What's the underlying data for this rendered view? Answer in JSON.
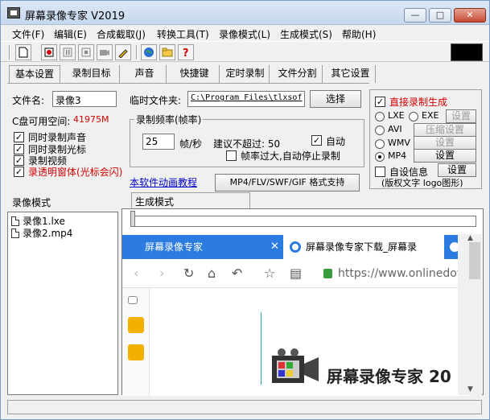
{
  "window": {
    "title": "屏幕录像专家 V2019",
    "min_label": "—",
    "max_label": "□",
    "close_label": "✕"
  },
  "menu": [
    "文件(F)",
    "编辑(E)",
    "合成截取(J)",
    "转换工具(T)",
    "录像模式(L)",
    "生成模式(S)",
    "帮助(H)"
  ],
  "toolbar": {
    "icons": [
      "new-file-icon",
      "record-icon",
      "pause-icon",
      "stop-icon",
      "stop2-icon",
      "camera-icon",
      "pen-icon",
      "globe-icon",
      "folder-icon",
      "help-icon"
    ]
  },
  "tabs": [
    "基本设置",
    "录制目标",
    "声音",
    "快捷键",
    "定时录制",
    "文件分割",
    "其它设置"
  ],
  "basic": {
    "filename_label": "文件名:",
    "filename_value": "录像3",
    "tempdir_label": "临时文件夹:",
    "tempdir_value": "C:\\Program Files\\tlxsof",
    "select_button": "选择",
    "disk_label": "C盘可用空间:",
    "disk_value": "41975M",
    "cb_sound": "同时录制声音",
    "cb_cursor": "同时录制光标",
    "cb_video": "录制视频",
    "cb_transparent": "录透明窗体(光标会闪)",
    "fps_group_title": "录制频率(帧率)",
    "fps_value": "25",
    "fps_unit": "帧/秒",
    "fps_limit": "建议不超过: 50",
    "auto_label": "自动",
    "stop_label": "帧率过大,自动停止录制",
    "tutorial_link": "本软件动画教程",
    "format_button": "MP4/FLV/SWF/GIF 格式支持"
  },
  "direct": {
    "title": "直接录制生成",
    "lxe": "LXE",
    "exe": "EXE",
    "avi": "AVI",
    "wmv": "WMV",
    "mp4": "MP4",
    "setting_label": "设置",
    "compress_label": "压缩设置",
    "custom_info": "自设信息",
    "copyright": "(版权文字 logo图形)"
  },
  "record_mode_label": "录像模式",
  "gen_mode_label": "生成模式",
  "files": [
    "录像1.lxe",
    "录像2.mp4"
  ],
  "browser": {
    "tab1": "屏幕录像专家",
    "tab2": "屏幕录像专家下载_屏幕录",
    "close_label": "✕",
    "url": "https://www.onlinedowr",
    "brand": "屏幕录像专家 20"
  },
  "scroll": {
    "up_label": "▲",
    "down_label": "▼"
  },
  "colors": {
    "browser_tab_blue": "#2b7be0",
    "red_text": "#d40000"
  }
}
